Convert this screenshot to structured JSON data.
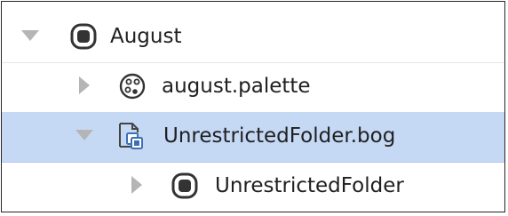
{
  "tree": {
    "items": [
      {
        "label": "August",
        "icon": "folder-icon",
        "expander": "expanded"
      },
      {
        "label": "august.palette",
        "icon": "palette-icon",
        "expander": "collapsed"
      },
      {
        "label": "UnrestrictedFolder.bog",
        "icon": "bog-file-icon",
        "expander": "expanded",
        "selected": true
      },
      {
        "label": "UnrestrictedFolder",
        "icon": "folder-icon",
        "expander": "collapsed"
      }
    ]
  },
  "colors": {
    "selection": "#c5d9f5",
    "text": "#202020",
    "expander": "#b5b5b5",
    "icon_stroke": "#333333",
    "bog_accent": "#3d6fb5",
    "border": "#262626"
  }
}
